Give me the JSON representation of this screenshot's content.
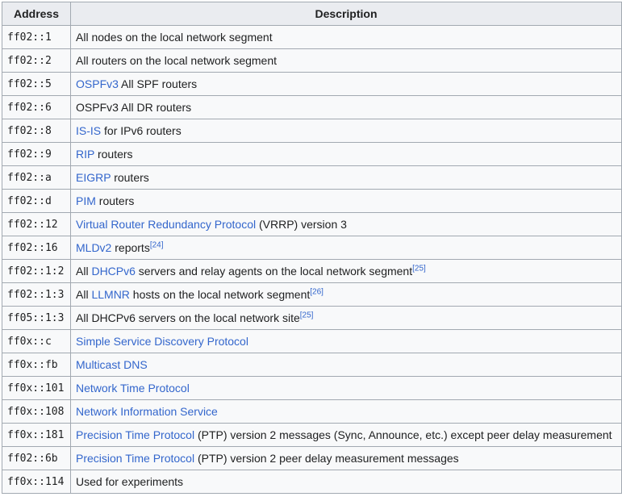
{
  "headers": {
    "address": "Address",
    "description": "Description"
  },
  "rows": [
    {
      "address": "ff02::1",
      "parts": [
        {
          "t": "All nodes on the local network segment"
        }
      ]
    },
    {
      "address": "ff02::2",
      "parts": [
        {
          "t": "All routers on the local network segment"
        }
      ]
    },
    {
      "address": "ff02::5",
      "parts": [
        {
          "t": "OSPFv3",
          "link": true
        },
        {
          "t": " All SPF routers"
        }
      ]
    },
    {
      "address": "ff02::6",
      "parts": [
        {
          "t": "OSPFv3 All DR routers"
        }
      ]
    },
    {
      "address": "ff02::8",
      "parts": [
        {
          "t": "IS-IS",
          "link": true
        },
        {
          "t": " for IPv6 routers"
        }
      ]
    },
    {
      "address": "ff02::9",
      "parts": [
        {
          "t": "RIP",
          "link": true
        },
        {
          "t": " routers"
        }
      ]
    },
    {
      "address": "ff02::a",
      "parts": [
        {
          "t": "EIGRP",
          "link": true
        },
        {
          "t": " routers"
        }
      ]
    },
    {
      "address": "ff02::d",
      "parts": [
        {
          "t": "PIM",
          "link": true
        },
        {
          "t": " routers"
        }
      ]
    },
    {
      "address": "ff02::12",
      "parts": [
        {
          "t": "Virtual Router Redundancy Protocol",
          "link": true
        },
        {
          "t": " (VRRP) version 3"
        }
      ]
    },
    {
      "address": "ff02::16",
      "parts": [
        {
          "t": "MLDv2",
          "link": true
        },
        {
          "t": " reports"
        },
        {
          "t": "[24]",
          "sup": true
        }
      ]
    },
    {
      "address": "ff02::1:2",
      "parts": [
        {
          "t": "All "
        },
        {
          "t": "DHCPv6",
          "link": true
        },
        {
          "t": " servers and relay agents on the local network segment"
        },
        {
          "t": "[25]",
          "sup": true
        }
      ]
    },
    {
      "address": "ff02::1:3",
      "parts": [
        {
          "t": "All "
        },
        {
          "t": "LLMNR",
          "link": true
        },
        {
          "t": " hosts on the local network segment"
        },
        {
          "t": "[26]",
          "sup": true
        }
      ]
    },
    {
      "address": "ff05::1:3",
      "parts": [
        {
          "t": "All DHCPv6 servers on the local network site"
        },
        {
          "t": "[25]",
          "sup": true
        }
      ]
    },
    {
      "address": "ff0x::c",
      "parts": [
        {
          "t": "Simple Service Discovery Protocol",
          "link": true
        }
      ]
    },
    {
      "address": "ff0x::fb",
      "parts": [
        {
          "t": "Multicast DNS",
          "link": true
        }
      ]
    },
    {
      "address": "ff0x::101",
      "parts": [
        {
          "t": "Network Time Protocol",
          "link": true
        }
      ]
    },
    {
      "address": "ff0x::108",
      "parts": [
        {
          "t": "Network Information Service",
          "link": true
        }
      ]
    },
    {
      "address": "ff0x::181",
      "parts": [
        {
          "t": "Precision Time Protocol",
          "link": true
        },
        {
          "t": " (PTP) version 2 messages (Sync, Announce, etc.) except peer delay measurement"
        }
      ]
    },
    {
      "address": "ff02::6b",
      "parts": [
        {
          "t": "Precision Time Protocol",
          "link": true
        },
        {
          "t": " (PTP) version 2 peer delay measurement messages"
        }
      ]
    },
    {
      "address": "ff0x::114",
      "parts": [
        {
          "t": "Used for experiments"
        }
      ]
    }
  ]
}
